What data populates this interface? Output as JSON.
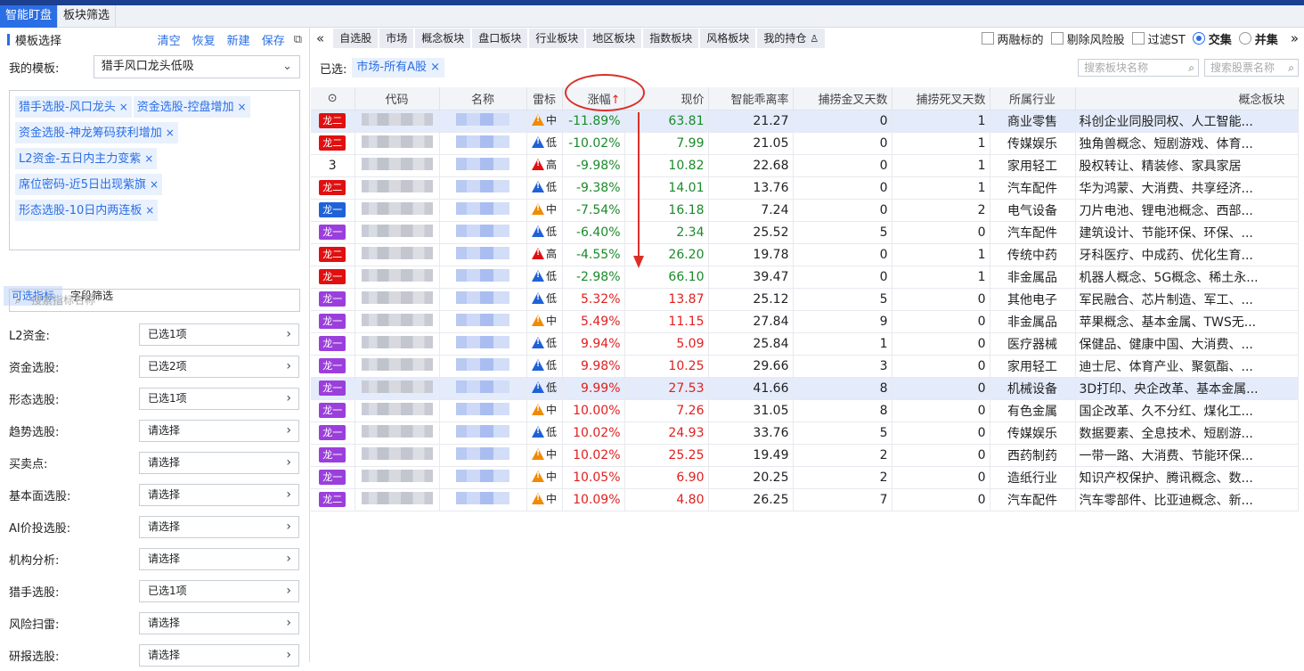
{
  "top_tabs": [
    "智能盯盘",
    "板块筛选"
  ],
  "left": {
    "header": {
      "title": "模板选择",
      "actions": [
        "清空",
        "恢复",
        "新建",
        "保存"
      ]
    },
    "template_label": "我的模板:",
    "template_value": "猎手风口龙头低吸",
    "chips": [
      "猎手选股-风口龙头",
      "资金选股-控盘增加",
      "资金选股-神龙筹码获利增加",
      "L2资金-五日内主力变紫",
      "席位密码-近5日出现紫旗",
      "形态选股-10日内两连板"
    ],
    "chip_close": "×",
    "subtabs": [
      "可选指标",
      "字段筛选"
    ],
    "search_placeholder": "搜索指标名称",
    "filters": [
      {
        "label": "L2资金:",
        "value": "已选1项"
      },
      {
        "label": "资金选股:",
        "value": "已选2项"
      },
      {
        "label": "形态选股:",
        "value": "已选1项"
      },
      {
        "label": "趋势选股:",
        "value": "请选择"
      },
      {
        "label": "买卖点:",
        "value": "请选择"
      },
      {
        "label": "基本面选股:",
        "value": "请选择"
      },
      {
        "label": "AI价投选股:",
        "value": "请选择"
      },
      {
        "label": "机构分析:",
        "value": "请选择"
      },
      {
        "label": "猎手选股:",
        "value": "已选1项"
      },
      {
        "label": "风险扫雷:",
        "value": "请选择"
      },
      {
        "label": "研报选股:",
        "value": "请选择"
      }
    ]
  },
  "right": {
    "filter_tabs": [
      "自选股",
      "市场",
      "概念板块",
      "盘口板块",
      "行业板块",
      "地区板块",
      "指数板块",
      "风格板块",
      "我的持仓"
    ],
    "options": {
      "margin": "两融标的",
      "exclude_risk": "剔除风险股",
      "filter_st": "过滤ST",
      "intersect": "交集",
      "union": "并集"
    },
    "selected_label": "已选:",
    "selected_chip": "市场-所有A股",
    "search_board_placeholder": "搜索板块名称",
    "search_stock_placeholder": "搜索股票名称",
    "columns": [
      "代码",
      "名称",
      "雷标",
      "涨幅",
      "现价",
      "智能乖离率",
      "捕捞金叉天数",
      "捕捞死叉天数",
      "所属行业",
      "概念板块"
    ],
    "sort_arrow": "↑",
    "rows": [
      {
        "tag": "龙二",
        "tagc": "red",
        "risk": "中",
        "riskc": "o",
        "chg": "-11.89%",
        "price": "63.81",
        "dev": "21.27",
        "gold": "0",
        "dead": "1",
        "ind": "商业零售",
        "concept": "科创企业同股同权、人工智能...",
        "hl": true
      },
      {
        "tag": "龙二",
        "tagc": "red",
        "risk": "低",
        "riskc": "b",
        "chg": "-10.02%",
        "price": "7.99",
        "dev": "21.05",
        "gold": "0",
        "dead": "1",
        "ind": "传媒娱乐",
        "concept": "独角兽概念、短剧游戏、体育...",
        "hl": false
      },
      {
        "tag": "3",
        "tagc": "",
        "risk": "高",
        "riskc": "r",
        "chg": "-9.98%",
        "price": "10.82",
        "dev": "22.68",
        "gold": "0",
        "dead": "1",
        "ind": "家用轻工",
        "concept": "股权转让、精装修、家具家居",
        "hl": false
      },
      {
        "tag": "龙二",
        "tagc": "red",
        "risk": "低",
        "riskc": "b",
        "chg": "-9.38%",
        "price": "14.01",
        "dev": "13.76",
        "gold": "0",
        "dead": "1",
        "ind": "汽车配件",
        "concept": "华为鸿蒙、大消费、共享经济...",
        "hl": false
      },
      {
        "tag": "龙一",
        "tagc": "blue",
        "risk": "中",
        "riskc": "o",
        "chg": "-7.54%",
        "price": "16.18",
        "dev": "7.24",
        "gold": "0",
        "dead": "2",
        "ind": "电气设备",
        "concept": "刀片电池、锂电池概念、西部...",
        "hl": false
      },
      {
        "tag": "龙一",
        "tagc": "purple",
        "risk": "低",
        "riskc": "b",
        "chg": "-6.40%",
        "price": "2.34",
        "dev": "25.52",
        "gold": "5",
        "dead": "0",
        "ind": "汽车配件",
        "concept": "建筑设计、节能环保、环保、...",
        "hl": false
      },
      {
        "tag": "龙二",
        "tagc": "red",
        "risk": "高",
        "riskc": "r",
        "chg": "-4.55%",
        "price": "26.20",
        "dev": "19.78",
        "gold": "0",
        "dead": "1",
        "ind": "传统中药",
        "concept": "牙科医疗、中成药、优化生育...",
        "hl": false
      },
      {
        "tag": "龙一",
        "tagc": "red",
        "risk": "低",
        "riskc": "b",
        "chg": "-2.98%",
        "price": "66.10",
        "dev": "39.47",
        "gold": "0",
        "dead": "1",
        "ind": "非金属品",
        "concept": "机器人概念、5G概念、稀土永...",
        "hl": false
      },
      {
        "tag": "龙一",
        "tagc": "purple",
        "risk": "低",
        "riskc": "b",
        "chg": "5.32%",
        "price": "13.87",
        "dev": "25.12",
        "gold": "5",
        "dead": "0",
        "ind": "其他电子",
        "concept": "军民融合、芯片制造、军工、...",
        "hl": false
      },
      {
        "tag": "龙一",
        "tagc": "purple",
        "risk": "中",
        "riskc": "o",
        "chg": "5.49%",
        "price": "11.15",
        "dev": "27.84",
        "gold": "9",
        "dead": "0",
        "ind": "非金属品",
        "concept": "苹果概念、基本金属、TWS无...",
        "hl": false
      },
      {
        "tag": "龙一",
        "tagc": "purple",
        "risk": "低",
        "riskc": "b",
        "chg": "9.94%",
        "price": "5.09",
        "dev": "25.84",
        "gold": "1",
        "dead": "0",
        "ind": "医疗器械",
        "concept": "保健品、健康中国、大消费、...",
        "hl": false
      },
      {
        "tag": "龙一",
        "tagc": "purple",
        "risk": "低",
        "riskc": "b",
        "chg": "9.98%",
        "price": "10.25",
        "dev": "29.66",
        "gold": "3",
        "dead": "0",
        "ind": "家用轻工",
        "concept": "迪士尼、体育产业、聚氨酯、...",
        "hl": false
      },
      {
        "tag": "龙一",
        "tagc": "purple",
        "risk": "低",
        "riskc": "b",
        "chg": "9.99%",
        "price": "27.53",
        "dev": "41.66",
        "gold": "8",
        "dead": "0",
        "ind": "机械设备",
        "concept": "3D打印、央企改革、基本金属...",
        "hl": true
      },
      {
        "tag": "龙一",
        "tagc": "purple",
        "risk": "中",
        "riskc": "o",
        "chg": "10.00%",
        "price": "7.26",
        "dev": "31.05",
        "gold": "8",
        "dead": "0",
        "ind": "有色金属",
        "concept": "国企改革、久不分红、煤化工...",
        "hl": false
      },
      {
        "tag": "龙一",
        "tagc": "purple",
        "risk": "低",
        "riskc": "b",
        "chg": "10.02%",
        "price": "24.93",
        "dev": "33.76",
        "gold": "5",
        "dead": "0",
        "ind": "传媒娱乐",
        "concept": "数据要素、全息技术、短剧游...",
        "hl": false
      },
      {
        "tag": "龙一",
        "tagc": "purple",
        "risk": "中",
        "riskc": "o",
        "chg": "10.02%",
        "price": "25.25",
        "dev": "19.49",
        "gold": "2",
        "dead": "0",
        "ind": "西药制药",
        "concept": "一带一路、大消费、节能环保...",
        "hl": false
      },
      {
        "tag": "龙一",
        "tagc": "purple",
        "risk": "中",
        "riskc": "o",
        "chg": "10.05%",
        "price": "6.90",
        "dev": "20.25",
        "gold": "2",
        "dead": "0",
        "ind": "造纸行业",
        "concept": "知识产权保护、腾讯概念、数...",
        "hl": false
      },
      {
        "tag": "龙二",
        "tagc": "purple",
        "risk": "中",
        "riskc": "o",
        "chg": "10.09%",
        "price": "4.80",
        "dev": "26.25",
        "gold": "7",
        "dead": "0",
        "ind": "汽车配件",
        "concept": "汽车零部件、比亚迪概念、新...",
        "hl": false
      }
    ]
  },
  "colors": {
    "accent": "#2a6ee5",
    "up": "#e02020",
    "down": "#1a8a2a",
    "annotation": "#d9312a"
  }
}
